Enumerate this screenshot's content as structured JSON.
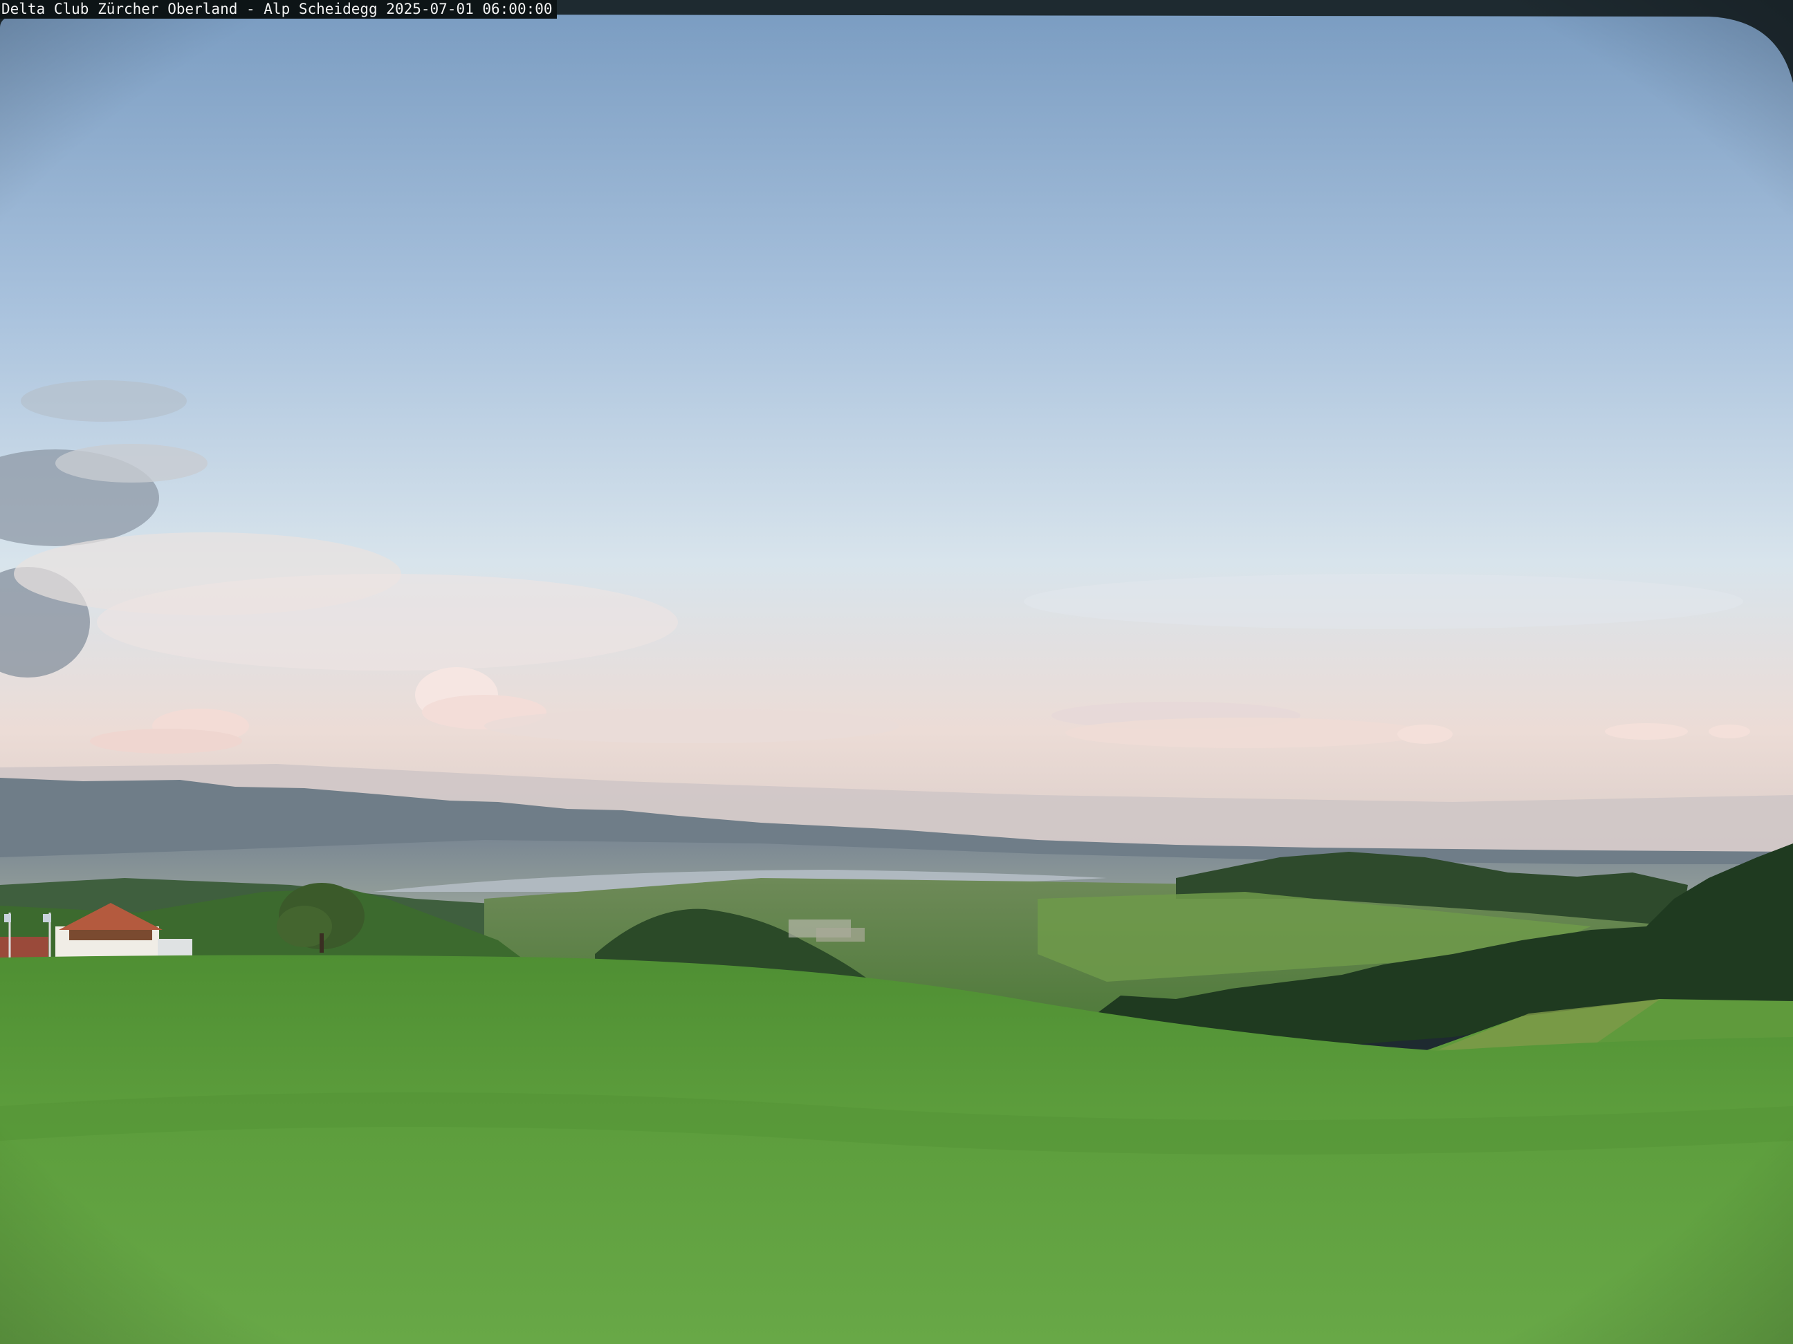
{
  "overlay": {
    "caption": "Delta Club Zürcher Oberland - Alp Scheidegg 2025-07-01 06:00:00"
  },
  "scene": {
    "sky_top": "#7fa0c4",
    "sky_mid": "#b8cde2",
    "sky_horizon": "#ecdcd6",
    "meadow": "#5a9a3a",
    "meadow_dark": "#3f7a2a",
    "forest": "#1f3d22",
    "valley_haze": "#8f9aa6",
    "distant_hills": "#5a6a74",
    "frame_dark": "#1e2a30"
  }
}
